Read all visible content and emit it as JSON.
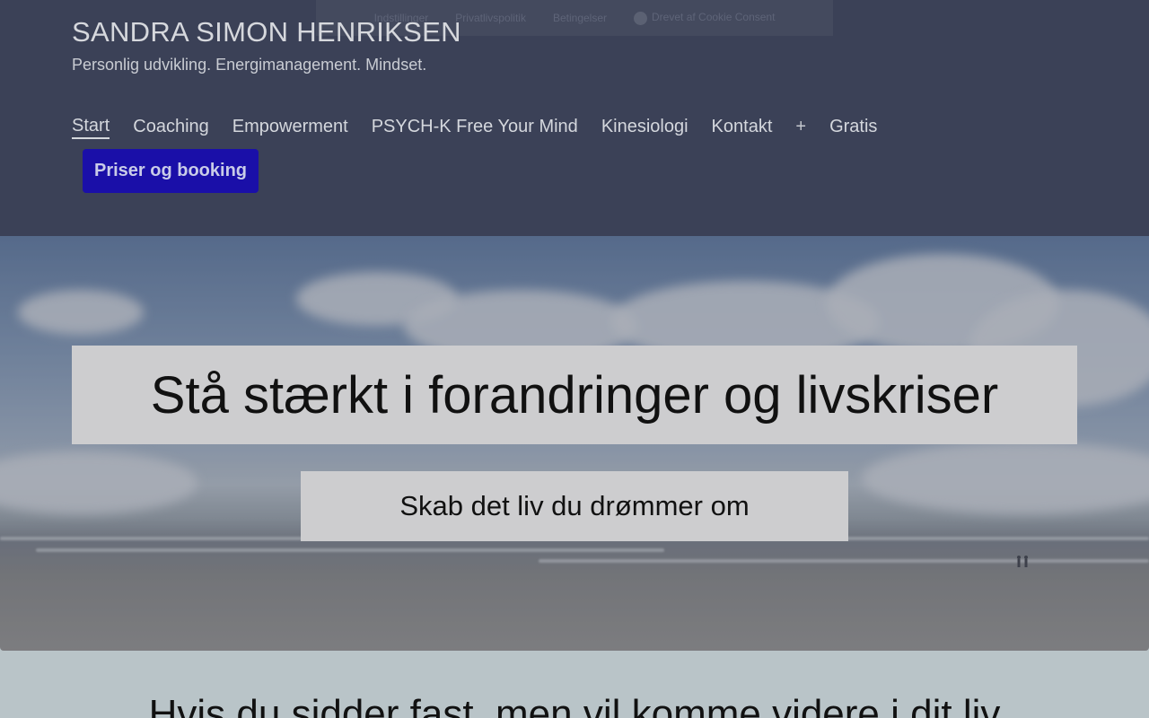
{
  "cookie_bar": {
    "links": [
      "Indstillinger",
      "Privatlivspolitik",
      "Betingelser",
      "Drevet af Cookie Consent"
    ]
  },
  "site": {
    "title": "SANDRA SIMON HENRIKSEN",
    "tagline": "Personlig udvikling. Energimanagement. Mindset."
  },
  "nav": {
    "items": [
      {
        "label": "Start",
        "active": true
      },
      {
        "label": "Coaching"
      },
      {
        "label": "Empowerment"
      },
      {
        "label": "PSYCH-K Free Your Mind"
      },
      {
        "label": "Kinesiologi"
      },
      {
        "label": "Kontakt"
      }
    ],
    "expand_icon": "+",
    "extra_item": "Gratis",
    "book_button": "Priser og booking"
  },
  "hero": {
    "heading": "Stå stærkt i forandringer og livskriser",
    "subheading": "Skab det liv du drømmer om"
  },
  "content": {
    "heading": "Hvis du sidder fast, men vil komme videre i dit liv"
  }
}
